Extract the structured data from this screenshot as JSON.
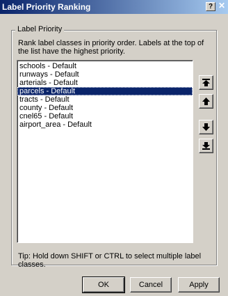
{
  "window": {
    "title": "Label Priority Ranking",
    "help_glyph": "?",
    "close_glyph": "✕"
  },
  "group": {
    "label": "Label Priority",
    "description": "Rank label classes in priority order. Labels at the top of the list have the highest priority."
  },
  "list": {
    "items": [
      {
        "label": "schools - Default"
      },
      {
        "label": "runways - Default"
      },
      {
        "label": "arterials - Default"
      },
      {
        "label": "parcels - Default"
      },
      {
        "label": "tracts - Default"
      },
      {
        "label": "county - Default"
      },
      {
        "label": "cnel65 - Default"
      },
      {
        "label": "airport_area - Default"
      }
    ],
    "selected_label": "parcels - Default"
  },
  "side_buttons": [
    {
      "icon": "move-to-top-icon"
    },
    {
      "icon": "move-up-icon"
    },
    {
      "icon": "move-down-icon"
    },
    {
      "icon": "move-to-bottom-icon"
    }
  ],
  "tip": "Tip: Hold down SHIFT or CTRL to select multiple label classes.",
  "buttons": {
    "ok": "OK",
    "cancel": "Cancel",
    "apply": "Apply"
  },
  "colors": {
    "selection": "#0a246a",
    "titlebar_start": "#0a246a",
    "titlebar_end": "#a6caf0",
    "face": "#d4d0c8"
  }
}
